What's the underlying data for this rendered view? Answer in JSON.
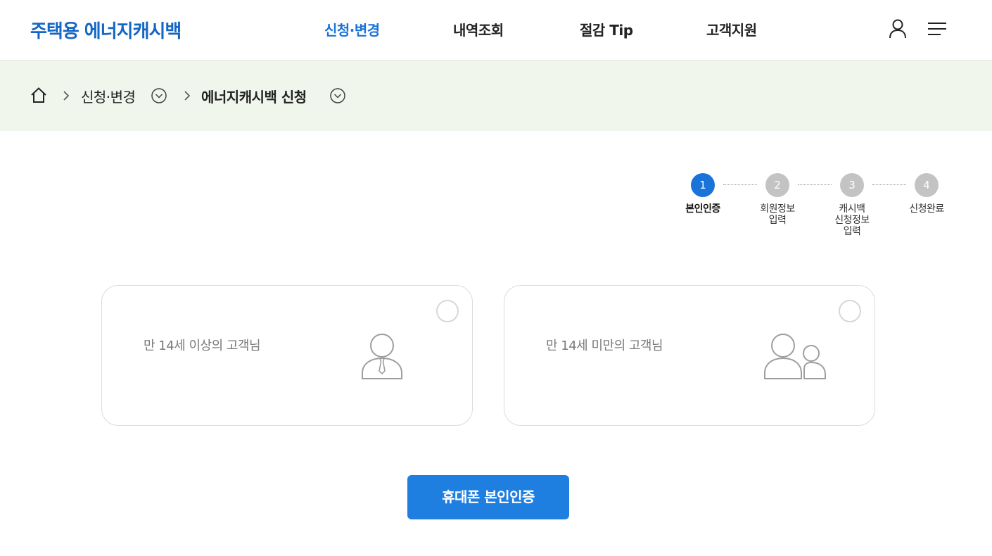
{
  "header": {
    "logo": "주택용 에너지캐시백",
    "nav": [
      "신청·변경",
      "내역조회",
      "절감 Tip",
      "고객지원"
    ],
    "active_nav": "신청·변경",
    "user_icon": "user-icon",
    "menu_icon": "hamburger-menu-icon"
  },
  "breadcrumb": {
    "home_icon": "home-icon",
    "level1": "신청·변경",
    "level2": "에너지캐시백 신청"
  },
  "steps": [
    {
      "number": "1",
      "label": "본인인증",
      "active": true
    },
    {
      "number": "2",
      "label": "회원정보\n입력",
      "active": false
    },
    {
      "number": "3",
      "label": "캐시백\n신청정보\n입력",
      "active": false
    },
    {
      "number": "4",
      "label": "신청완료",
      "active": false
    }
  ],
  "options": [
    {
      "label": "만 14세 이상의 고객님",
      "icon": "adult-person-icon",
      "selected": false
    },
    {
      "label": "만 14세 미만의 고객님",
      "icon": "parent-child-icon",
      "selected": false
    }
  ],
  "cta": {
    "label": "휴대폰 본인인증"
  },
  "colors": {
    "brand": "#1466c4",
    "accent": "#1a73d9",
    "button": "#1f7fe0",
    "breadcrumb_bg": "#f1f6ec",
    "step_inactive": "#c3c3c3"
  }
}
